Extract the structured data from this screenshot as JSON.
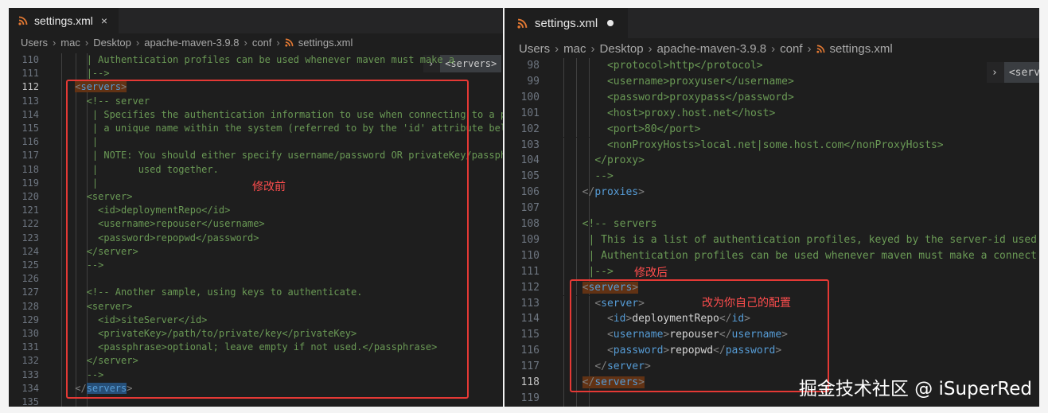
{
  "left": {
    "tab": {
      "title": "settings.xml",
      "close": "×"
    },
    "breadcrumb": [
      "Users",
      "mac",
      "Desktop",
      "apache-maven-3.9.8",
      "conf",
      "settings.xml"
    ],
    "sticky": {
      "label": "<servers>"
    },
    "annotation": "修改前",
    "current_line": "112",
    "lines": [
      {
        "n": "110",
        "segs": [
          [
            "c",
            "| Authentication profiles can be used whenever maven must make a"
          ]
        ],
        "indent": "   "
      },
      {
        "n": "111",
        "segs": [
          [
            "c",
            "|-->"
          ]
        ],
        "indent": "   "
      },
      {
        "n": "112",
        "segs": [
          [
            "p",
            "<"
          ],
          [
            "t",
            "servers"
          ],
          [
            "p",
            ">"
          ]
        ],
        "indent": " "
      },
      {
        "n": "113",
        "segs": [
          [
            "c",
            "<!-- server"
          ]
        ],
        "indent": "   "
      },
      {
        "n": "114",
        "segs": [
          [
            "c",
            "| Specifies the authentication information to use when connecting to a parti"
          ]
        ],
        "indent": "    "
      },
      {
        "n": "115",
        "segs": [
          [
            "c",
            "| a unique name within the system (referred to by the 'id' attribute below)."
          ]
        ],
        "indent": "    "
      },
      {
        "n": "116",
        "segs": [
          [
            "c",
            "|"
          ]
        ],
        "indent": "    "
      },
      {
        "n": "117",
        "segs": [
          [
            "c",
            "| NOTE: You should either specify username/password OR privateKey/passphrase"
          ]
        ],
        "indent": "    "
      },
      {
        "n": "118",
        "segs": [
          [
            "c",
            "|       used together."
          ]
        ],
        "indent": "    "
      },
      {
        "n": "119",
        "segs": [
          [
            "c",
            "|"
          ]
        ],
        "indent": "    "
      },
      {
        "n": "120",
        "segs": [
          [
            "c",
            "<server>"
          ]
        ],
        "indent": "   "
      },
      {
        "n": "121",
        "segs": [
          [
            "c",
            "<id>deploymentRepo</id>"
          ]
        ],
        "indent": "     "
      },
      {
        "n": "122",
        "segs": [
          [
            "c",
            "<username>repouser</username>"
          ]
        ],
        "indent": "     "
      },
      {
        "n": "123",
        "segs": [
          [
            "c",
            "<password>repopwd</password>"
          ]
        ],
        "indent": "     "
      },
      {
        "n": "124",
        "segs": [
          [
            "c",
            "</server>"
          ]
        ],
        "indent": "   "
      },
      {
        "n": "125",
        "segs": [
          [
            "c",
            "-->"
          ]
        ],
        "indent": "   "
      },
      {
        "n": "126",
        "segs": [],
        "indent": ""
      },
      {
        "n": "127",
        "segs": [
          [
            "c",
            "<!-- Another sample, using keys to authenticate."
          ]
        ],
        "indent": "   "
      },
      {
        "n": "128",
        "segs": [
          [
            "c",
            "<server>"
          ]
        ],
        "indent": "   "
      },
      {
        "n": "129",
        "segs": [
          [
            "c",
            "<id>siteServer</id>"
          ]
        ],
        "indent": "     "
      },
      {
        "n": "130",
        "segs": [
          [
            "c",
            "<privateKey>/path/to/private/key</privateKey>"
          ]
        ],
        "indent": "     "
      },
      {
        "n": "131",
        "segs": [
          [
            "c",
            "<passphrase>optional; leave empty if not used.</passphrase>"
          ]
        ],
        "indent": "     "
      },
      {
        "n": "132",
        "segs": [
          [
            "c",
            "</server>"
          ]
        ],
        "indent": "   "
      },
      {
        "n": "133",
        "segs": [
          [
            "c",
            "-->"
          ]
        ],
        "indent": "   "
      },
      {
        "n": "134",
        "segs": [
          [
            "p",
            "</"
          ],
          [
            "t",
            "servers"
          ],
          [
            "p",
            ">"
          ]
        ],
        "indent": " "
      },
      {
        "n": "135",
        "segs": [],
        "indent": ""
      }
    ]
  },
  "right": {
    "tab": {
      "title": "settings.xml"
    },
    "breadcrumb": [
      "Users",
      "mac",
      "Desktop",
      "apache-maven-3.9.8",
      "conf",
      "settings.xml"
    ],
    "sticky": {
      "label": "<serve"
    },
    "annotation_after": "修改后",
    "annotation_own": "改为你自己的配置",
    "current_line": "118",
    "lines": [
      {
        "n": "98",
        "segs": [
          [
            "c",
            "<protocol>http</protocol>"
          ]
        ],
        "indent": "      "
      },
      {
        "n": "99",
        "segs": [
          [
            "c",
            "<username>proxyuser</username>"
          ]
        ],
        "indent": "      "
      },
      {
        "n": "100",
        "segs": [
          [
            "c",
            "<password>proxypass</password>"
          ]
        ],
        "indent": "      "
      },
      {
        "n": "101",
        "segs": [
          [
            "c",
            "<host>proxy.host.net</host>"
          ]
        ],
        "indent": "      "
      },
      {
        "n": "102",
        "segs": [
          [
            "c",
            "<port>80</port>"
          ]
        ],
        "indent": "      "
      },
      {
        "n": "103",
        "segs": [
          [
            "c",
            "<nonProxyHosts>local.net|some.host.com</nonProxyHosts>"
          ]
        ],
        "indent": "      "
      },
      {
        "n": "104",
        "segs": [
          [
            "c",
            "</proxy>"
          ]
        ],
        "indent": "    "
      },
      {
        "n": "105",
        "segs": [
          [
            "c",
            "-->"
          ]
        ],
        "indent": "    "
      },
      {
        "n": "106",
        "segs": [
          [
            "p",
            "</"
          ],
          [
            "t",
            "proxies"
          ],
          [
            "p",
            ">"
          ]
        ],
        "indent": "  "
      },
      {
        "n": "107",
        "segs": [],
        "indent": ""
      },
      {
        "n": "108",
        "segs": [
          [
            "c",
            "<!-- servers"
          ]
        ],
        "indent": "  "
      },
      {
        "n": "109",
        "segs": [
          [
            "c",
            "| This is a list of authentication profiles, keyed by the server-id used"
          ]
        ],
        "indent": "   "
      },
      {
        "n": "110",
        "segs": [
          [
            "c",
            "| Authentication profiles can be used whenever maven must make a connect"
          ]
        ],
        "indent": "   "
      },
      {
        "n": "111",
        "segs": [
          [
            "c",
            "|-->"
          ]
        ],
        "indent": "   "
      },
      {
        "n": "112",
        "segs": [
          [
            "p",
            "<"
          ],
          [
            "t",
            "servers"
          ],
          [
            "p",
            ">"
          ]
        ],
        "indent": "  "
      },
      {
        "n": "113",
        "segs": [
          [
            "p",
            "<"
          ],
          [
            "t",
            "server"
          ],
          [
            "p",
            ">"
          ]
        ],
        "indent": "    "
      },
      {
        "n": "114",
        "segs": [
          [
            "p",
            "<"
          ],
          [
            "t",
            "id"
          ],
          [
            "p",
            ">"
          ],
          [
            "x",
            "deploymentRepo"
          ],
          [
            "p",
            "</"
          ],
          [
            "t",
            "id"
          ],
          [
            "p",
            ">"
          ]
        ],
        "indent": "      "
      },
      {
        "n": "115",
        "segs": [
          [
            "p",
            "<"
          ],
          [
            "t",
            "username"
          ],
          [
            "p",
            ">"
          ],
          [
            "x",
            "repouser"
          ],
          [
            "p",
            "</"
          ],
          [
            "t",
            "username"
          ],
          [
            "p",
            ">"
          ]
        ],
        "indent": "      "
      },
      {
        "n": "116",
        "segs": [
          [
            "p",
            "<"
          ],
          [
            "t",
            "password"
          ],
          [
            "p",
            ">"
          ],
          [
            "x",
            "repopwd"
          ],
          [
            "p",
            "</"
          ],
          [
            "t",
            "password"
          ],
          [
            "p",
            ">"
          ]
        ],
        "indent": "      "
      },
      {
        "n": "117",
        "segs": [
          [
            "p",
            "</"
          ],
          [
            "t",
            "server"
          ],
          [
            "p",
            ">"
          ]
        ],
        "indent": "    "
      },
      {
        "n": "118",
        "segs": [
          [
            "p",
            "</"
          ],
          [
            "t",
            "servers"
          ],
          [
            "p",
            ">"
          ]
        ],
        "indent": "  "
      },
      {
        "n": "119",
        "segs": [],
        "indent": ""
      }
    ]
  },
  "watermark": "掘金技术社区 @ iSuperRed"
}
